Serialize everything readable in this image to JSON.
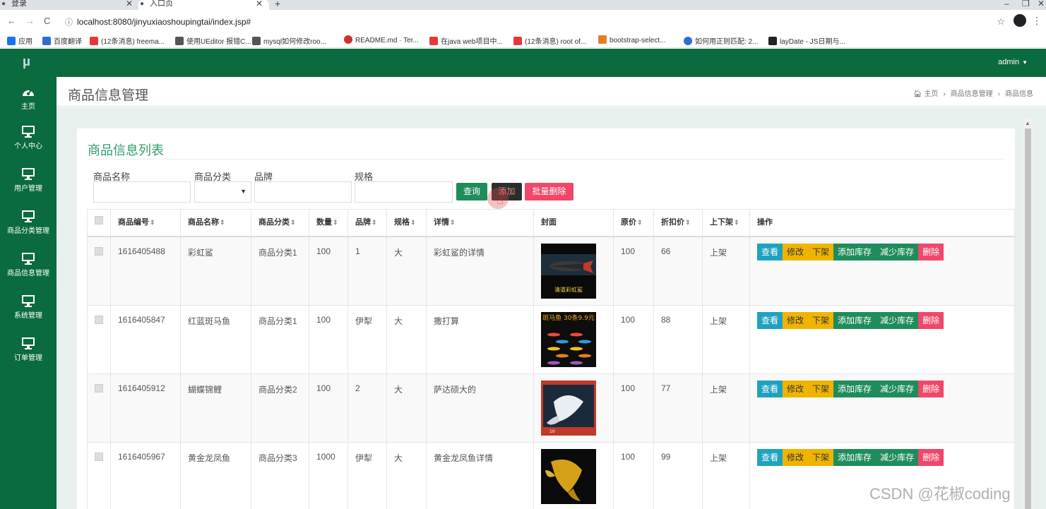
{
  "browser": {
    "tabs": [
      {
        "title": "登录",
        "active": false
      },
      {
        "title": "入口页",
        "active": true
      }
    ],
    "url": "localhost:8080/jinyuxiaoshoupingtai/index.jsp#",
    "bookmarks": [
      {
        "label": "应用",
        "color": "#1a73e8"
      },
      {
        "label": "百度翻译",
        "color": "#2b6fd6"
      },
      {
        "label": "(12条消息) freema...",
        "color": "#e53935"
      },
      {
        "label": "使用UEditor 报错C...",
        "color": "#555555"
      },
      {
        "label": "mysql如何修改roo...",
        "color": "#555555"
      },
      {
        "label": "README.md · Ter...",
        "color": "#d32f2f"
      },
      {
        "label": "在java web项目中...",
        "color": "#e53935"
      },
      {
        "label": "(12条消息) root of...",
        "color": "#e53935"
      },
      {
        "label": "bootstrap-select...",
        "color": "#e67e22"
      },
      {
        "label": "如何用正则匹配: 2...",
        "color": "#2b6fd6"
      },
      {
        "label": "layDate - JS日期与...",
        "color": "#222222"
      }
    ]
  },
  "app": {
    "logo": "μ",
    "user": "admin",
    "sidebar": [
      {
        "label": "主页",
        "icon": "dashboard-icon"
      },
      {
        "label": "个人中心",
        "icon": "monitor-icon"
      },
      {
        "label": "用户管理",
        "icon": "monitor-icon"
      },
      {
        "label": "商品分类管理",
        "icon": "monitor-icon"
      },
      {
        "label": "商品信息管理",
        "icon": "monitor-icon"
      },
      {
        "label": "系统管理",
        "icon": "monitor-icon"
      },
      {
        "label": "订单管理",
        "icon": "monitor-icon"
      }
    ],
    "page_title": "商品信息管理",
    "breadcrumb": [
      "主页",
      "商品信息管理",
      "商品信息"
    ]
  },
  "list": {
    "title": "商品信息列表",
    "filters": {
      "name_label": "商品名称",
      "category_label": "商品分类",
      "brand_label": "品牌",
      "spec_label": "规格"
    },
    "buttons": {
      "query": "查询",
      "add": "添加",
      "batch_delete": "批量删除"
    },
    "columns": [
      "商品编号",
      "商品名称",
      "商品分类",
      "数量",
      "品牌",
      "规格",
      "详情",
      "封面",
      "原价",
      "折扣价",
      "上下架",
      "操作"
    ],
    "row_actions": [
      "查看",
      "修改",
      "下架",
      "添加库存",
      "减少库存",
      "删除"
    ],
    "rows": [
      {
        "id": "1616405488",
        "name": "彩虹鲨",
        "category": "商品分类1",
        "qty": "100",
        "brand": "1",
        "spec": "大",
        "detail": "彩虹鲨的详情",
        "price": "100",
        "discount": "66",
        "status": "上架",
        "cover_text": "清道彩虹鲨"
      },
      {
        "id": "1616405847",
        "name": "红蓝斑马鱼",
        "category": "商品分类1",
        "qty": "100",
        "brand": "伊犁",
        "spec": "大",
        "detail": "撒打算",
        "price": "100",
        "discount": "88",
        "status": "上架",
        "cover_text": "斑马鱼 30条9.9元"
      },
      {
        "id": "1616405912",
        "name": "蝴蝶锦鲤",
        "category": "商品分类2",
        "qty": "100",
        "brand": "2",
        "spec": "大",
        "detail": "萨达硕大的",
        "price": "100",
        "discount": "77",
        "status": "上架",
        "cover_text": "10"
      },
      {
        "id": "1616405967",
        "name": "黄金龙凤鱼",
        "category": "商品分类3",
        "qty": "1000",
        "brand": "伊犁",
        "spec": "大",
        "detail": "黄金龙凤鱼详情",
        "price": "100",
        "discount": "99",
        "status": "上架",
        "cover_text": ""
      }
    ]
  },
  "watermark": "CSDN @花椒coding"
}
